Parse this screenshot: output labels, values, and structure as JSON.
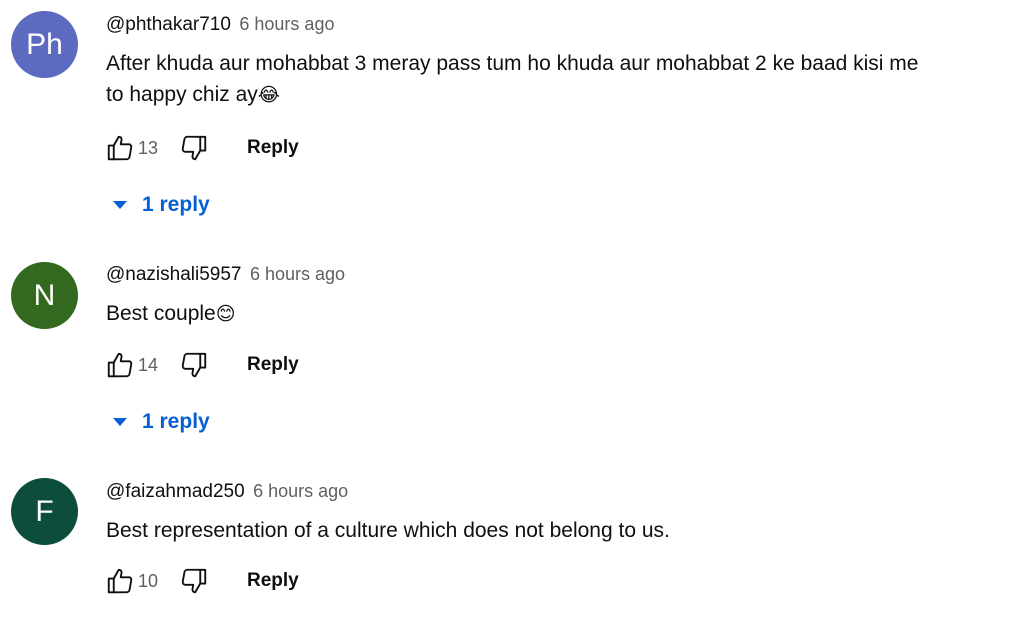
{
  "comments": [
    {
      "avatar_initials": "Ph",
      "avatar_color": "#5c6bc0",
      "author": "@phthakar710",
      "time": "6 hours ago",
      "text_line1": "After khuda aur mohabbat 3 meray pass tum ho khuda aur mohabbat 2 ke baad kisi me",
      "text_line2": "to happy chiz ay",
      "emoji": "😂",
      "likes": "13",
      "reply_label": "Reply",
      "replies_label": "1 reply"
    },
    {
      "avatar_initials": "N",
      "avatar_color": "#33691e",
      "author": "@nazishali5957",
      "time": "6 hours ago",
      "text_line1": "Best couple",
      "emoji": "😊",
      "likes": "14",
      "reply_label": "Reply",
      "replies_label": "1 reply"
    },
    {
      "avatar_initials": "F",
      "avatar_color": "#0d4d3b",
      "author": "@faizahmad250",
      "time": "6 hours ago",
      "text_line1": "Best representation of a culture which does not belong to us.",
      "likes": "10",
      "reply_label": "Reply"
    }
  ]
}
